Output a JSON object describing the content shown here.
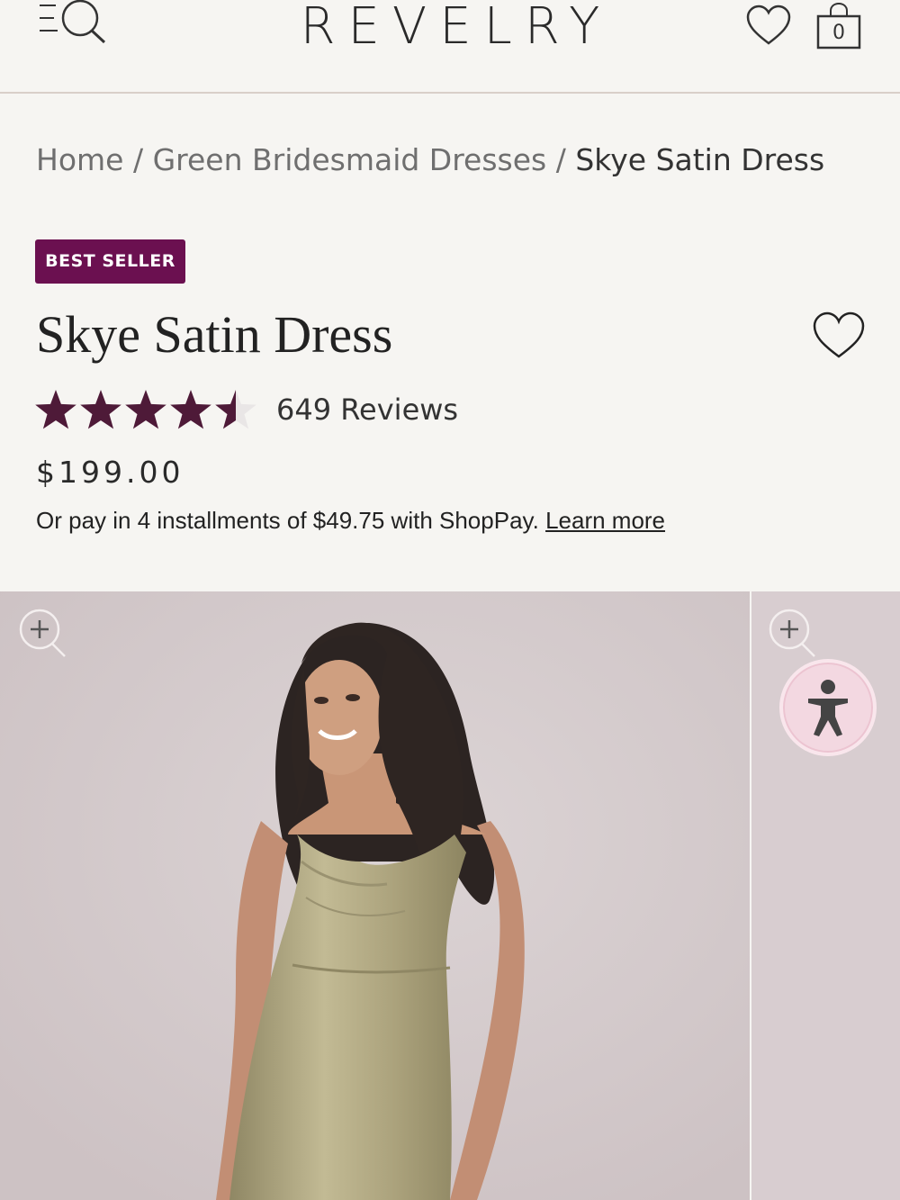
{
  "header": {
    "logo": "REVELRY",
    "cart_count": "0",
    "icons": [
      "menu-search-icon",
      "heart-icon",
      "shopping-bag-icon"
    ]
  },
  "breadcrumb": {
    "items": [
      "Home",
      "Green Bridesmaid Dresses",
      "Skye Satin Dress"
    ],
    "separator": "/"
  },
  "product": {
    "badge": "BEST SELLER",
    "title": "Skye Satin Dress",
    "rating": 4.5,
    "rating_max": 5,
    "reviews": "649 Reviews",
    "price": "$199.00",
    "installments_text": "Or pay in 4 installments of $49.75 with ShopPay.",
    "learn_more": "Learn more"
  },
  "colors": {
    "badge": "#6b1050",
    "stars": "#4e1a38",
    "photo_bg": "#d6cdcf",
    "dress": "#b3aa82",
    "accessibility_bg": "#f3d8e1"
  }
}
